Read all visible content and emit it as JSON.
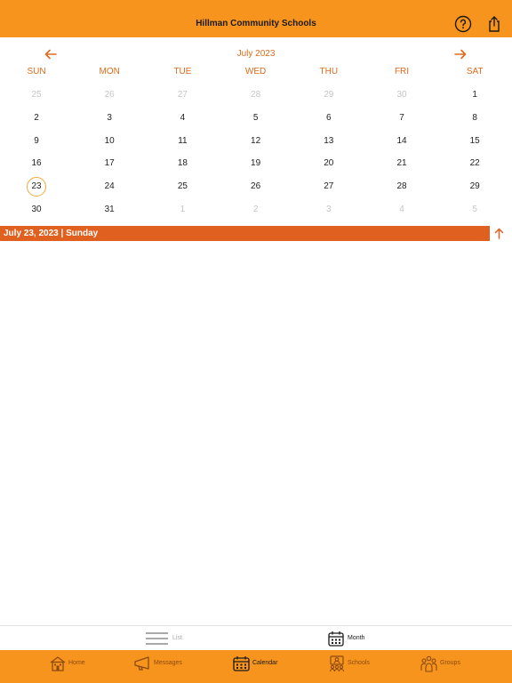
{
  "header": {
    "title": "Hillman Community Schools"
  },
  "calendar": {
    "month_label": "July 2023",
    "weekdays": [
      "SUN",
      "MON",
      "TUE",
      "WED",
      "THU",
      "FRI",
      "SAT"
    ],
    "weeks": [
      [
        {
          "d": "25",
          "m": true
        },
        {
          "d": "26",
          "m": true
        },
        {
          "d": "27",
          "m": true
        },
        {
          "d": "28",
          "m": true
        },
        {
          "d": "29",
          "m": true
        },
        {
          "d": "30",
          "m": true
        },
        {
          "d": "1"
        }
      ],
      [
        {
          "d": "2"
        },
        {
          "d": "3"
        },
        {
          "d": "4"
        },
        {
          "d": "5"
        },
        {
          "d": "6"
        },
        {
          "d": "7"
        },
        {
          "d": "8"
        }
      ],
      [
        {
          "d": "9"
        },
        {
          "d": "10"
        },
        {
          "d": "11"
        },
        {
          "d": "12"
        },
        {
          "d": "13"
        },
        {
          "d": "14"
        },
        {
          "d": "15"
        }
      ],
      [
        {
          "d": "16"
        },
        {
          "d": "17"
        },
        {
          "d": "18"
        },
        {
          "d": "19"
        },
        {
          "d": "20"
        },
        {
          "d": "21"
        },
        {
          "d": "22"
        }
      ],
      [
        {
          "d": "23",
          "s": true
        },
        {
          "d": "24"
        },
        {
          "d": "25"
        },
        {
          "d": "26"
        },
        {
          "d": "27"
        },
        {
          "d": "28"
        },
        {
          "d": "29"
        }
      ],
      [
        {
          "d": "30"
        },
        {
          "d": "31"
        },
        {
          "d": "1",
          "m": true
        },
        {
          "d": "2",
          "m": true
        },
        {
          "d": "3",
          "m": true
        },
        {
          "d": "4",
          "m": true
        },
        {
          "d": "5",
          "m": true
        }
      ]
    ],
    "selected_date_label": "July 23, 2023 | Sunday"
  },
  "view_switch": {
    "list_label": "List",
    "month_label": "Month",
    "active": "Month"
  },
  "tabs": [
    {
      "label": "Home",
      "icon": "school-house-icon"
    },
    {
      "label": "Messages",
      "icon": "megaphone-icon"
    },
    {
      "label": "Calendar",
      "icon": "calendar-icon"
    },
    {
      "label": "Schools",
      "icon": "schools-icon"
    },
    {
      "label": "Groups",
      "icon": "groups-icon"
    }
  ],
  "active_tab": "Calendar",
  "colors": {
    "header_bg": "#f7941d",
    "accent": "#e06a1b",
    "selected_bar": "#e0611f",
    "muted_day": "#c4c4c4",
    "tab_inactive_text": "#8a4a10"
  }
}
